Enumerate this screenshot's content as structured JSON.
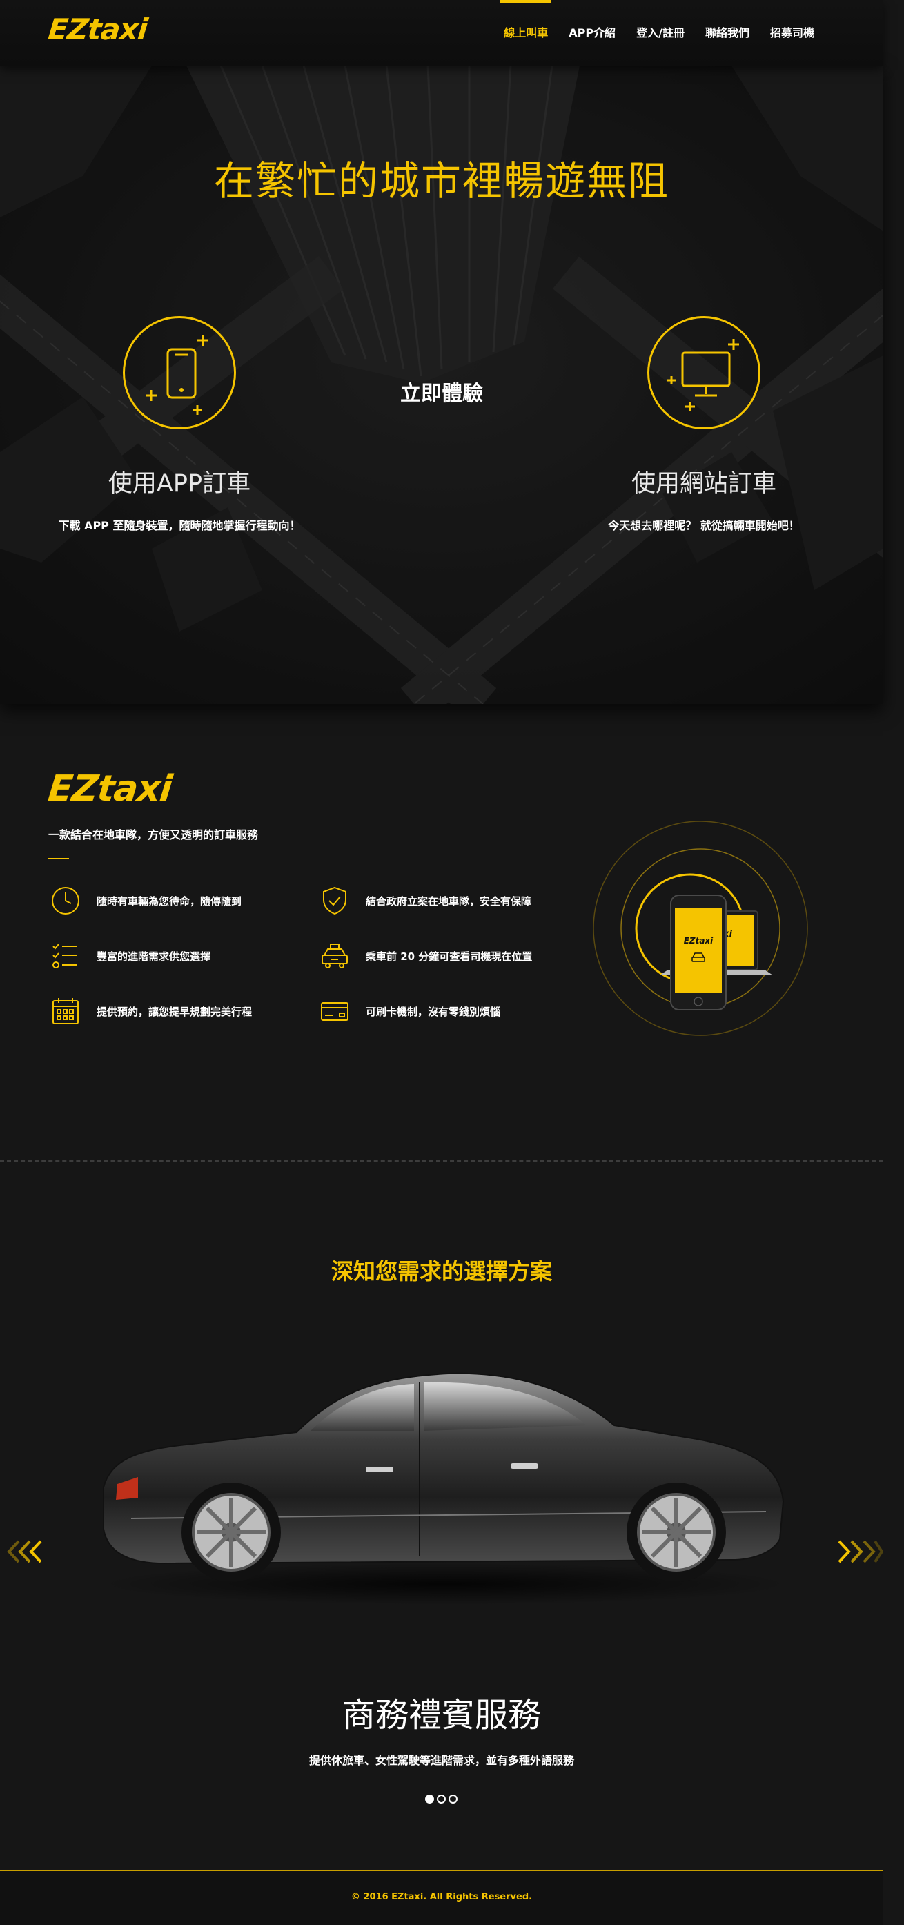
{
  "brand": {
    "logo": "EZtaxi",
    "accent": "#f5c400"
  },
  "nav": {
    "items": [
      {
        "label": "線上叫車",
        "active": true
      },
      {
        "label": "APP介紹",
        "active": false
      },
      {
        "label": "登入/註冊",
        "active": false
      },
      {
        "label": "聯絡我們",
        "active": false
      },
      {
        "label": "招募司機",
        "active": false
      }
    ]
  },
  "hero": {
    "title": "在繁忙的城市裡暢遊無阻",
    "center_cta": "立即體驗",
    "app": {
      "title": "使用APP訂車",
      "desc": "下載 APP 至隨身裝置，隨時隨地掌握行程動向！",
      "icon": "phone-icon"
    },
    "web": {
      "title": "使用網站訂車",
      "desc": "今天想去哪裡呢？ 就從搞輛車開始吧！",
      "icon": "monitor-icon"
    }
  },
  "about": {
    "logo": "EZtaxi",
    "tagline": "一款結合在地車隊，方便又透明的訂車服務",
    "features": [
      {
        "icon": "clock-icon",
        "text": "隨時有車輛為您待命，隨傳隨到"
      },
      {
        "icon": "shield-check-icon",
        "text": "結合政府立案在地車隊，安全有保障"
      },
      {
        "icon": "checklist-icon",
        "text": "豐富的進階需求供您選擇"
      },
      {
        "icon": "taxi-icon",
        "text": "乘車前 20 分鐘可查看司機現在位置"
      },
      {
        "icon": "calendar-icon",
        "text": "提供預約，讓您提早規劃完美行程"
      },
      {
        "icon": "credit-card-icon",
        "text": "可刷卡機制，沒有零錢別煩惱"
      }
    ],
    "device_logo": "EZtaxi"
  },
  "plans": {
    "title": "深知您需求的選擇方案",
    "slide": {
      "title": "商務禮賓服務",
      "desc": "提供休旅車、女性駕駛等進階需求，並有多種外語服務"
    },
    "slide_count": 3,
    "active_slide": 1
  },
  "footer": {
    "copyright": "© 2016 EZtaxi. All Rights Reserved."
  }
}
